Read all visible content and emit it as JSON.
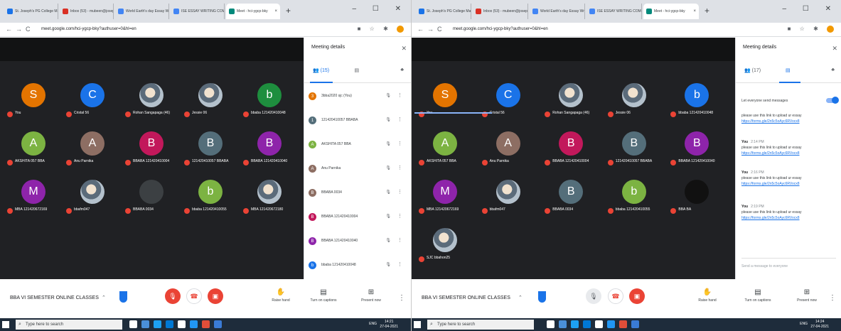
{
  "left": {
    "tabs": [
      {
        "title": "St. Joseph's PG College Mail",
        "fav": "#1a73e8"
      },
      {
        "title": "Inbox (53) - mubeen@josep",
        "fav": "#d93025"
      },
      {
        "title": "World Earth's day Essay Wri",
        "fav": "#4285f4"
      },
      {
        "title": "ISE ESSAY WRITING COMPE",
        "fav": "#4285f4"
      },
      {
        "title": "Meet - hci-ygcp-bky",
        "fav": "#00897b"
      }
    ],
    "url": "meet.google.com/hci-ygcp-bky?authuser=0&hl=en",
    "tiles": [
      {
        "letter": "S",
        "color": "#e37400",
        "name": "You"
      },
      {
        "letter": "C",
        "color": "#1a73e8",
        "name": "Cristal 56"
      },
      {
        "letter": "",
        "color": "photo",
        "name": "Rohan Sangapaga (46)"
      },
      {
        "letter": "",
        "color": "photo",
        "name": "Jessie 06"
      },
      {
        "letter": "b",
        "color": "#1e8e3e",
        "name": "bbaba 121420410048"
      },
      {
        "letter": "A",
        "color": "#7cb342",
        "name": "AKSHITA 057 BBA"
      },
      {
        "letter": "A",
        "color": "#8d6e63",
        "name": "Anu Parnika"
      },
      {
        "letter": "B",
        "color": "#c2185b",
        "name": "BBABA 121420410004"
      },
      {
        "letter": "B",
        "color": "#546e7a",
        "name": "121420410057 BBABA"
      },
      {
        "letter": "B",
        "color": "#8e24aa",
        "name": "BBABA 121420410040"
      },
      {
        "letter": "M",
        "color": "#8e24aa",
        "name": "MBA 121420672169"
      },
      {
        "letter": "",
        "color": "photo",
        "name": "bbafm047"
      },
      {
        "letter": "",
        "color": "#3c4043",
        "name": "BBABA 0034"
      },
      {
        "letter": "b",
        "color": "#7cb342",
        "name": "bbaba 121420410055"
      },
      {
        "letter": "",
        "color": "photo",
        "name": "MBA 121420672180"
      }
    ],
    "panel": {
      "title": "Meeting details",
      "people_tab": "(15)",
      "people": [
        {
          "letter": "3",
          "color": "#e37400",
          "name": "3bba2020 sjc (You)"
        },
        {
          "letter": "1",
          "color": "#546e7a",
          "name": "121420410057 BBABA"
        },
        {
          "letter": "A",
          "color": "#7cb342",
          "name": "AKSHITA 057 BBA"
        },
        {
          "letter": "A",
          "color": "#8d6e63",
          "name": "Anu Parnika"
        },
        {
          "letter": "B",
          "color": "#8d6e63",
          "name": "BBABA 0034"
        },
        {
          "letter": "B",
          "color": "#c2185b",
          "name": "BBABA 121420410004"
        },
        {
          "letter": "B",
          "color": "#8e24aa",
          "name": "BBABA 121420410040"
        },
        {
          "letter": "b",
          "color": "#1a73e8",
          "name": "bbaba 121420410048"
        }
      ]
    },
    "meeting_name": "BBA VI SEMESTER ONLINE CLASSES",
    "raise_hand": "Raise hand",
    "captions": "Turn on captions",
    "present": "Present now",
    "search_placeholder": "Type here to search",
    "tray": "ENG",
    "time": "14:21",
    "date": "27-04-2021"
  },
  "right": {
    "tabs": [
      {
        "title": "St. Joseph's PG College Mail",
        "fav": "#1a73e8"
      },
      {
        "title": "Inbox (53) - mubeen@josep",
        "fav": "#d93025"
      },
      {
        "title": "World Earth's day Essay Wri",
        "fav": "#4285f4"
      },
      {
        "title": "ISE ESSAY WRITING COMPE",
        "fav": "#4285f4"
      },
      {
        "title": "Meet - hci-ygcp-bky",
        "fav": "#00897b"
      }
    ],
    "url": "meet.google.com/hci-ygcp-bky?authuser=0&hl=en",
    "tiles": [
      {
        "letter": "S",
        "color": "#e37400",
        "name": "You"
      },
      {
        "letter": "C",
        "color": "#1a73e8",
        "name": "Cristal 56"
      },
      {
        "letter": "",
        "color": "photo",
        "name": "Rohan Sangapaga (46)"
      },
      {
        "letter": "",
        "color": "photo",
        "name": "Jessie 06"
      },
      {
        "letter": "b",
        "color": "#1a73e8",
        "name": "bbaba 121420410048"
      },
      {
        "letter": "A",
        "color": "#7cb342",
        "name": "AKSHITA 057 BBA"
      },
      {
        "letter": "A",
        "color": "#8d6e63",
        "name": "Anu Parnika"
      },
      {
        "letter": "B",
        "color": "#c2185b",
        "name": "BBABA 121420410004"
      },
      {
        "letter": "B",
        "color": "#546e7a",
        "name": "121420410057 BBABA"
      },
      {
        "letter": "B",
        "color": "#8e24aa",
        "name": "BBABA 121420410040"
      },
      {
        "letter": "M",
        "color": "#8e24aa",
        "name": "MBA 121420672169"
      },
      {
        "letter": "",
        "color": "photo",
        "name": "bbafm047"
      },
      {
        "letter": "B",
        "color": "#546e7a",
        "name": "BBABA 0034"
      },
      {
        "letter": "b",
        "color": "#7cb342",
        "name": "bbaba 121420410055"
      },
      {
        "letter": "",
        "color": "#111111",
        "name": "BBA BA"
      },
      {
        "letter": "",
        "color": "photo",
        "name": "SJC bbahon25"
      }
    ],
    "panel": {
      "title": "Meeting details",
      "people_tab": "(17)",
      "toggle_label": "Let everyone send messages",
      "messages": [
        {
          "who": "",
          "time": "",
          "text": "please use this link to upload ur essay",
          "link": "https://forms.gle/2n5c5oAyc6RVocx8"
        },
        {
          "who": "You",
          "time": "2:14 PM",
          "text": "please use this link to upload ur essay",
          "link": "https://forms.gle/2n5c5oAyc6RVocx8"
        },
        {
          "who": "You",
          "time": "2:16 PM",
          "text": "please use this link to upload ur essay",
          "link": "https://forms.gle/2n5c5oAyc6RVocx8"
        },
        {
          "who": "You",
          "time": "2:19 PM",
          "text": "please use this link to upload ur essay",
          "link": "https://forms.gle/2n5c5oAyc6RVocx8"
        }
      ],
      "send_placeholder": "Send a message to everyone"
    },
    "meeting_name": "BBA VI SEMESTER ONLINE CLASSES",
    "raise_hand": "Raise hand",
    "captions": "Turn on captions",
    "present": "Present now",
    "search_placeholder": "Type here to search",
    "tray": "ENG",
    "time": "14:24",
    "date": "27-04-2021"
  }
}
